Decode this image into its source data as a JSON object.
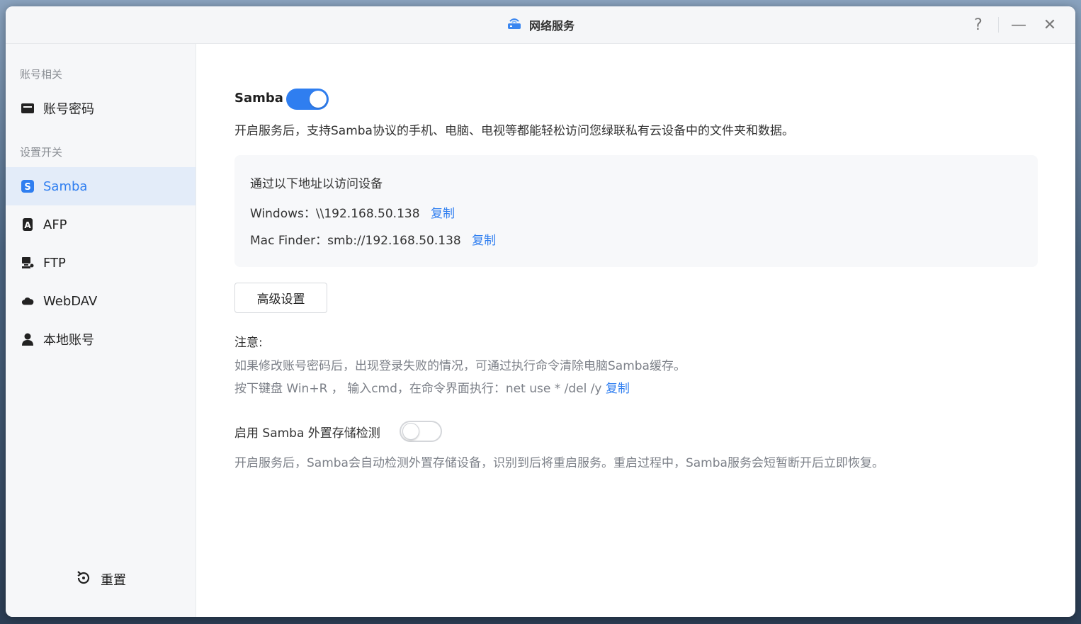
{
  "window": {
    "title": "网络服务"
  },
  "controls": {
    "help": "?",
    "minimize": "—",
    "close": "✕"
  },
  "sidebar": {
    "group_account": "账号相关",
    "group_settings": "设置开关",
    "items": [
      {
        "label": "账号密码",
        "icon": "id-card-icon"
      },
      {
        "label": "Samba",
        "icon": "samba-icon"
      },
      {
        "label": "AFP",
        "icon": "afp-icon"
      },
      {
        "label": "FTP",
        "icon": "ftp-icon"
      },
      {
        "label": "WebDAV",
        "icon": "cloud-icon"
      },
      {
        "label": "本地账号",
        "icon": "user-icon"
      }
    ],
    "active": "Samba",
    "reset_label": "重置"
  },
  "main": {
    "samba_title": "Samba",
    "samba_enabled": true,
    "samba_desc": "开启服务后，支持Samba协议的手机、电脑、电视等都能轻松访问您绿联私有云设备中的文件夹和数据。",
    "access": {
      "heading": "通过以下地址以访问设备",
      "windows_label": "Windows：",
      "windows_address": "\\\\192.168.50.138",
      "mac_label": "Mac Finder：",
      "mac_address": "smb://192.168.50.138",
      "copy_label": "复制"
    },
    "advanced_button": "高级设置",
    "note": {
      "title": "注意:",
      "line1": "如果修改账号密码后，出现登录失败的情况，可通过执行命令清除电脑Samba缓存。",
      "line2": "按下键盘 Win+R ， 输入cmd，在命令界面执行：net use * /del /y",
      "copy_label": "复制"
    },
    "external": {
      "label": "启用 Samba 外置存储检测",
      "enabled": false,
      "desc": "开启服务后，Samba会自动检测外置存储设备，识别到后将重启服务。重启过程中，Samba服务会短暂断开后立即恢复。"
    }
  },
  "colors": {
    "accent": "#2f7ef0",
    "active_bg": "#e3ecf9"
  }
}
